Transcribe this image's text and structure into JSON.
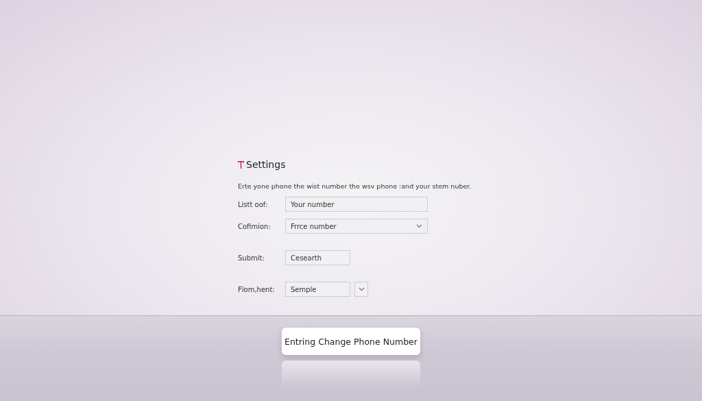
{
  "panel": {
    "title": "Settings",
    "description": "Erte yone phone the wist number the wsv phone :and your stem nuber.",
    "rows": [
      {
        "kind": "text",
        "label": "Listt oof:",
        "value": "Your number"
      },
      {
        "kind": "select",
        "label": "Cofimion:",
        "value": "Frrce number"
      },
      {
        "kind": "short",
        "label": "Submit:",
        "value": "Cesearth"
      },
      {
        "kind": "short-dropdown",
        "label": "Flom,hent:",
        "value": "Semple"
      }
    ]
  },
  "caption": "Entring Change Phone Number"
}
